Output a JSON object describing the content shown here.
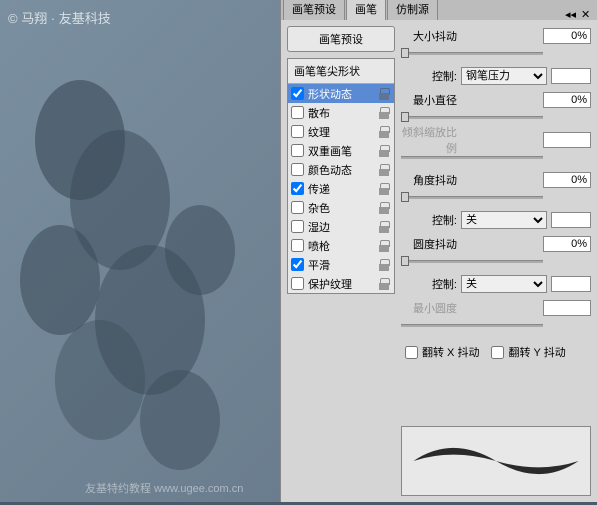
{
  "watermark_tl": "© 马翔 · 友基科技",
  "watermark_br": "友基特约教程  www.ugee.com.cn",
  "tabs": [
    "画笔预设",
    "画笔",
    "仿制源"
  ],
  "active_tab": 1,
  "preset_button": "画笔预设",
  "option_header": "画笔笔尖形状",
  "options": [
    {
      "label": "形状动态",
      "checked": true,
      "selected": true
    },
    {
      "label": "散布",
      "checked": false
    },
    {
      "label": "纹理",
      "checked": false
    },
    {
      "label": "双重画笔",
      "checked": false
    },
    {
      "label": "颜色动态",
      "checked": false
    },
    {
      "label": "传递",
      "checked": true
    },
    {
      "label": "杂色",
      "checked": false
    },
    {
      "label": "湿边",
      "checked": false
    },
    {
      "label": "喷枪",
      "checked": false
    },
    {
      "label": "平滑",
      "checked": true
    },
    {
      "label": "保护纹理",
      "checked": false
    }
  ],
  "controls": {
    "size_jitter": {
      "label": "大小抖动",
      "value": "0%"
    },
    "control1": {
      "label": "控制:",
      "value": "钢笔压力"
    },
    "min_diameter": {
      "label": "最小直径",
      "value": "0%"
    },
    "tilt_scale": {
      "label": "倾斜缩放比例"
    },
    "angle_jitter": {
      "label": "角度抖动",
      "value": "0%"
    },
    "control2": {
      "label": "控制:",
      "value": "关"
    },
    "roundness_jitter": {
      "label": "圆度抖动",
      "value": "0%"
    },
    "control3": {
      "label": "控制:",
      "value": "关"
    },
    "min_roundness": {
      "label": "最小圆度"
    },
    "flip_x": "翻转 X 抖动",
    "flip_y": "翻转 Y 抖动"
  }
}
